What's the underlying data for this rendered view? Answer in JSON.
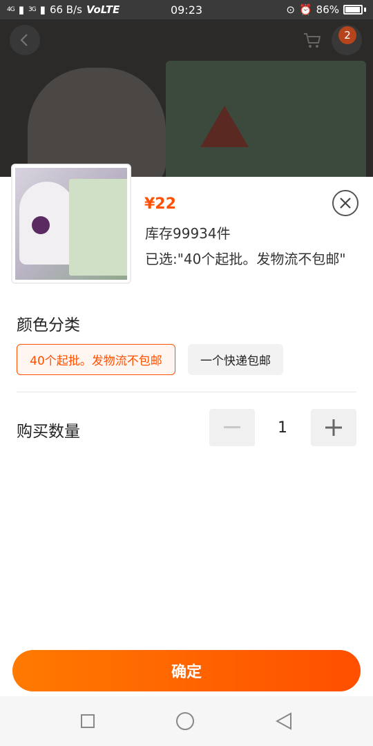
{
  "status_bar": {
    "signal_1": "4G",
    "signal_2": "3G",
    "speed": "66 B/s",
    "volte": "VoLTE",
    "time": "09:23",
    "battery": "86%",
    "battery_level": 0.86
  },
  "header": {
    "cart_badge": "2",
    "back_icon": "back-arrow-icon",
    "cart_icon": "cart-icon"
  },
  "product": {
    "price": "¥22",
    "stock": "库存99934件",
    "selected": "已选:\"40个起批。发物流不包邮\""
  },
  "color_section": {
    "title": "颜色分类",
    "options": [
      {
        "label": "40个起批。发物流不包邮",
        "selected": true
      },
      {
        "label": "一个快递包邮",
        "selected": false
      }
    ]
  },
  "quantity": {
    "label": "购买数量",
    "value": "1"
  },
  "confirm_button": "确定",
  "colors": {
    "accent": "#ff5000",
    "button_start": "#ff7a00",
    "button_end": "#ff4f00"
  }
}
